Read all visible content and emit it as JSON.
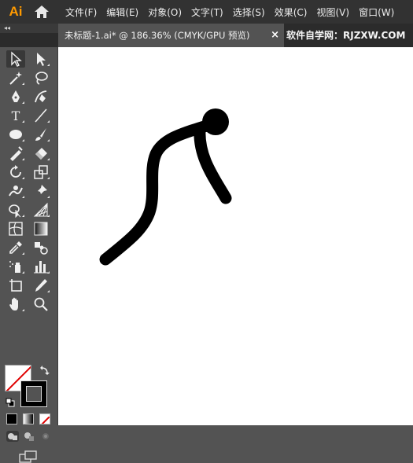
{
  "app": {
    "logo_text": "Ai"
  },
  "menu": {
    "items": [
      {
        "label": "文件(F)"
      },
      {
        "label": "编辑(E)"
      },
      {
        "label": "对象(O)"
      },
      {
        "label": "文字(T)"
      },
      {
        "label": "选择(S)"
      },
      {
        "label": "效果(C)"
      },
      {
        "label": "视图(V)"
      },
      {
        "label": "窗口(W)"
      }
    ]
  },
  "tabs": {
    "collapse_label": "◂◂",
    "document_title": "未标题-1.ai* @ 186.36% (CMYK/GPU 预览)",
    "close_glyph": "×"
  },
  "watermark": {
    "text": "软件自学网：RJZXW.COM"
  },
  "toolbar": {
    "type_tool_glyph": "T",
    "fill_color": "#ffffff",
    "stroke_color": "#000000"
  },
  "canvas": {
    "background": "#ffffff",
    "stroke_color": "#000000"
  }
}
